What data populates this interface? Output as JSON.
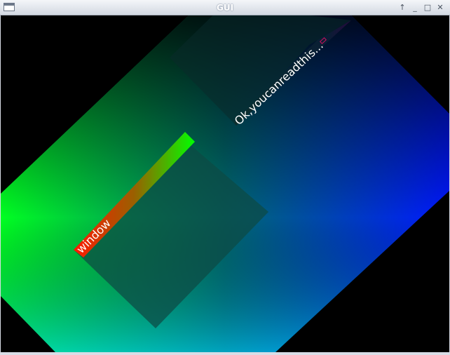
{
  "window": {
    "title": "GUI",
    "controls": {
      "shade": "↑",
      "minimize": "_",
      "maximize": "□",
      "close": "✕"
    }
  },
  "scene": {
    "panel_label": "Ok,youcanreadthis...",
    "window_label": "window",
    "colors": {
      "background": "#000000",
      "gradient_top": "#000000",
      "gradient_left": "#00ff22",
      "gradient_right": "#0018ff",
      "gradient_bottom": "#00c8ff",
      "titlebar_left": "#ff1a00",
      "titlebar_right": "#00ff00",
      "close_box": "#d01060"
    }
  }
}
